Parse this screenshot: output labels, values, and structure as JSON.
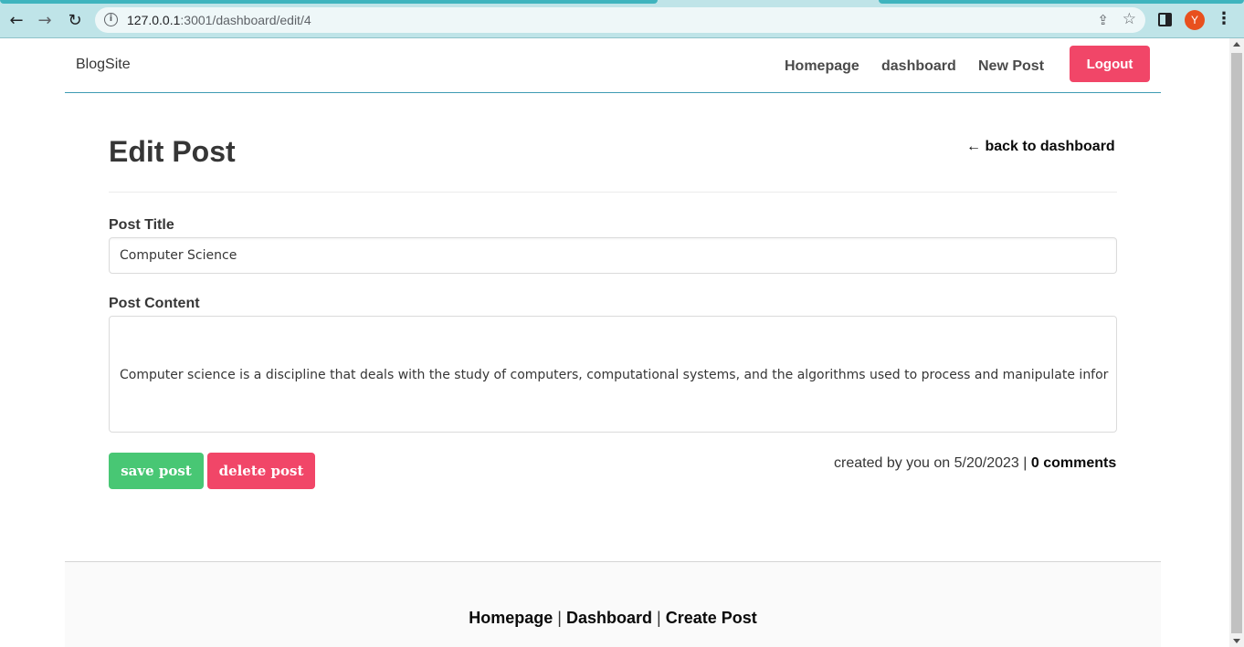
{
  "browser": {
    "url_host": "127.0.0.1",
    "url_path": ":3001/dashboard/edit/4",
    "avatar_letter": "Y",
    "avatar_color": "#e8501e"
  },
  "navbar": {
    "brand": "BlogSite",
    "links": [
      "Homepage",
      "dashboard",
      "New Post"
    ],
    "logout_label": "Logout"
  },
  "main": {
    "title": "Edit Post",
    "back_link": "← back to dashboard",
    "title_label": "Post Title",
    "title_value": "Computer Science",
    "content_label": "Post Content",
    "content_value": "Computer science is a discipline that deals with the study of computers, computational systems, and the algorithms used to process and manipulate infor",
    "save_label": "save post",
    "delete_label": "delete post",
    "meta_prefix": "created by you on 5/20/2023 |",
    "comments_link": "0 comments"
  },
  "footer": {
    "links": [
      "Homepage",
      "Dashboard",
      "Create Post"
    ],
    "separator": "|"
  },
  "colors": {
    "success": "#48c774",
    "danger": "#f14668",
    "chrome": "#bfe4e8"
  }
}
